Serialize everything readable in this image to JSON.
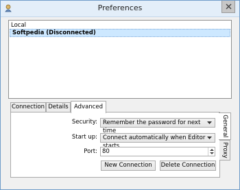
{
  "window": {
    "title": "Preferences"
  },
  "connections": {
    "group_label": "Local",
    "items": [
      {
        "label": "Softpedia (Disconnected)",
        "selected": true
      }
    ]
  },
  "tabs": [
    {
      "label": "Connection",
      "active": false
    },
    {
      "label": "Details",
      "active": false
    },
    {
      "label": "Advanced",
      "active": true
    }
  ],
  "side_tabs": [
    {
      "label": "General",
      "active": true
    },
    {
      "label": "Proxy",
      "active": false
    }
  ],
  "advanced": {
    "security_label": "Security:",
    "security_value": "Remember the password for next time",
    "startup_label": "Start up:",
    "startup_value": "Connect automatically when Editor starts",
    "port_label": "Port:",
    "port_value": "80",
    "new_connection_label": "New Connection",
    "delete_connection_label": "Delete Connection"
  },
  "colors": {
    "selection": "#cde8ff",
    "title_bar": "#e3eef9",
    "window_border": "#6f9cc9"
  },
  "icons": {
    "app": "app-icon",
    "close": "close-icon",
    "dropdown": "chevron-down-icon",
    "spinner_up": "spin-up-icon",
    "spinner_down": "spin-down-icon"
  }
}
